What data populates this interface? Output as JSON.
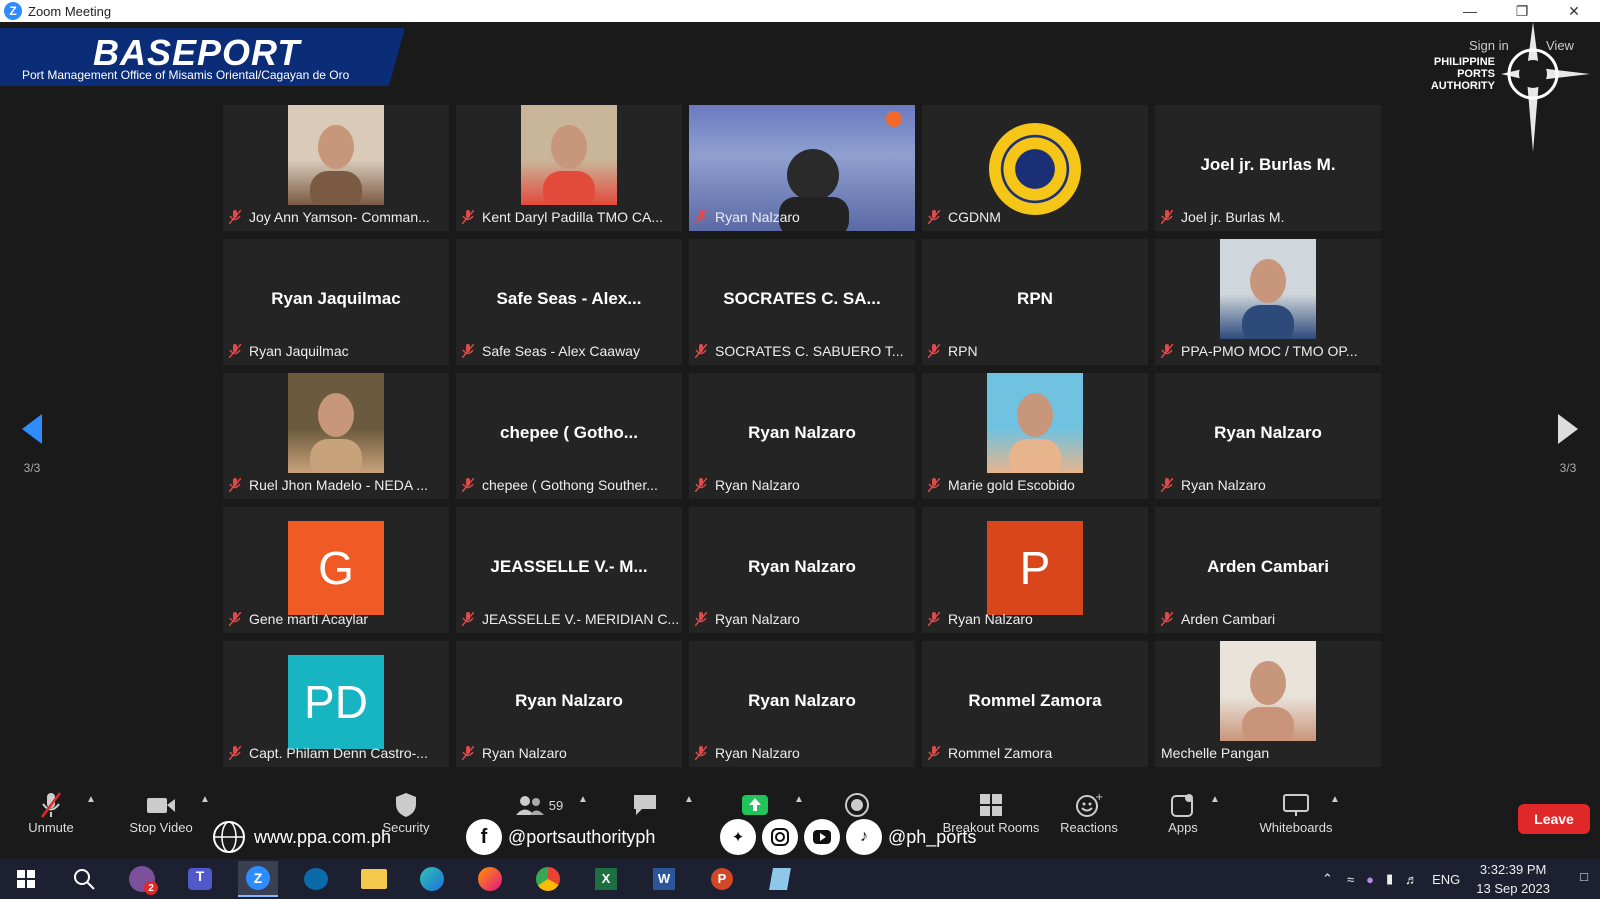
{
  "window": {
    "title": "Zoom Meeting"
  },
  "banner": {
    "title": "BASEPORT",
    "subtitle": "Port Management Office of Misamis Oriental/Cagayan de Oro"
  },
  "ppa_logo": {
    "text_lines": [
      "PHILIPPINE",
      "PORTS",
      "AUTHORITY"
    ]
  },
  "header_links": {
    "sign_in": "Sign in",
    "view": "View"
  },
  "pagination": {
    "left": "3/3",
    "right": "3/3"
  },
  "tiles": [
    {
      "kind": "photo",
      "label": "Joy Ann Yamson- Comman...",
      "muted": true
    },
    {
      "kind": "photo",
      "label": "Kent Daryl Padilla TMO CA...",
      "muted": true
    },
    {
      "kind": "screen",
      "label": "Ryan Nalzaro",
      "muted": true
    },
    {
      "kind": "seal",
      "label": "CGDNM",
      "muted": true
    },
    {
      "kind": "name",
      "display": "Joel jr. Burlas M.",
      "label": "Joel jr. Burlas M.",
      "muted": true
    },
    {
      "kind": "name",
      "display": "Ryan Jaquilmac",
      "label": "Ryan Jaquilmac",
      "muted": true
    },
    {
      "kind": "name",
      "display": "Safe Seas - Alex...",
      "label": "Safe Seas - Alex Caaway",
      "muted": true
    },
    {
      "kind": "name",
      "display": "SOCRATES C. SA...",
      "label": "SOCRATES C. SABUERO T...",
      "muted": true
    },
    {
      "kind": "name",
      "display": "RPN",
      "label": "RPN",
      "muted": true
    },
    {
      "kind": "photo",
      "label": "PPA-PMO MOC / TMO OP...",
      "muted": true
    },
    {
      "kind": "photo",
      "label": "Ruel Jhon Madelo - NEDA ...",
      "muted": true
    },
    {
      "kind": "name",
      "display": "chepee ( Gotho...",
      "label": "chepee ( Gothong Souther...",
      "muted": true
    },
    {
      "kind": "name",
      "display": "Ryan Nalzaro",
      "label": "Ryan Nalzaro",
      "muted": true
    },
    {
      "kind": "photo",
      "label": "Marie gold Escobido",
      "muted": true
    },
    {
      "kind": "name",
      "display": "Ryan Nalzaro",
      "label": "Ryan Nalzaro",
      "muted": true
    },
    {
      "kind": "avatar",
      "initials": "G",
      "color": "#f05a24",
      "label": "Gene marti Acaylar",
      "muted": true
    },
    {
      "kind": "name",
      "display": "JEASSELLE V.- M...",
      "label": "JEASSELLE V.- MERIDIAN C...",
      "muted": true
    },
    {
      "kind": "name",
      "display": "Ryan Nalzaro",
      "label": "Ryan Nalzaro",
      "muted": true
    },
    {
      "kind": "avatar",
      "initials": "P",
      "color": "#d9461c",
      "label": "Ryan Nalzaro",
      "muted": true
    },
    {
      "kind": "name",
      "display": "Arden Cambari",
      "label": "Arden Cambari",
      "muted": true
    },
    {
      "kind": "avatar",
      "initials": "PD",
      "color": "#17b5c2",
      "label": "Capt. Philam Denn Castro-...",
      "muted": true
    },
    {
      "kind": "name",
      "display": "Ryan Nalzaro",
      "label": "Ryan Nalzaro",
      "muted": true
    },
    {
      "kind": "name",
      "display": "Ryan Nalzaro",
      "label": "Ryan Nalzaro",
      "muted": true
    },
    {
      "kind": "name",
      "display": "Rommel Zamora",
      "label": "Rommel Zamora",
      "muted": true
    },
    {
      "kind": "photo",
      "label": "Mechelle Pangan",
      "muted": false
    }
  ],
  "toolbar": {
    "unmute": "Unmute",
    "stop_video": "Stop Video",
    "security": "Security",
    "participants_count": "59",
    "breakout_rooms": "Breakout Rooms",
    "reactions": "Reactions",
    "apps": "Apps",
    "whiteboards": "Whiteboards",
    "leave": "Leave"
  },
  "social": {
    "website": "www.ppa.com.ph",
    "facebook": "@portsauthorityph",
    "handles": "@ph_ports"
  },
  "taskbar": {
    "zoom_badge": "2",
    "lang": "ENG",
    "time": "3:32:39 PM",
    "date": "13 Sep 2023"
  }
}
